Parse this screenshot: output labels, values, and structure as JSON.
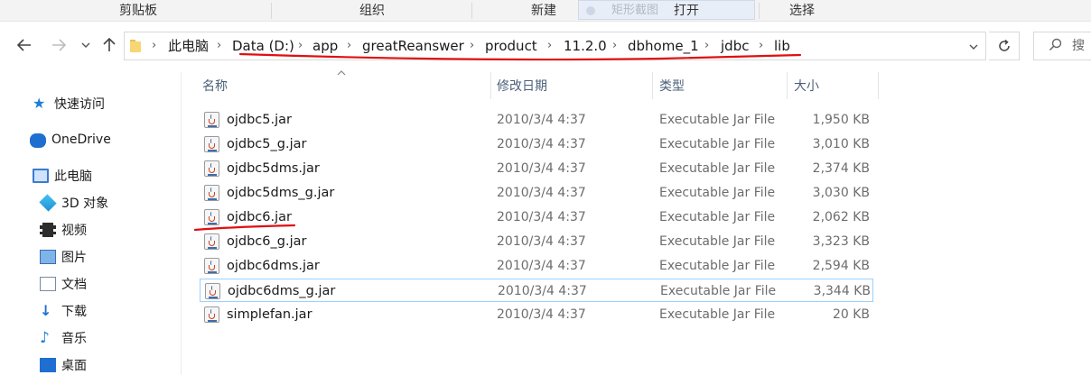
{
  "ribbon": {
    "groups": [
      "剪贴板",
      "组织",
      "新建",
      "打开",
      "选择"
    ],
    "ghost_label": "矩形截图"
  },
  "nav": {
    "breadcrumbs": [
      "此电脑",
      "Data (D:)",
      "app",
      "greatReanswer",
      "product",
      "11.2.0",
      "dbhome_1",
      "jdbc",
      "lib"
    ],
    "search_placeholder": "搜"
  },
  "sidebar": {
    "items": [
      {
        "label": "快速访问",
        "icon": "star-icon"
      },
      {
        "label": "OneDrive",
        "icon": "cloud-icon"
      },
      {
        "label": "此电脑",
        "icon": "computer-icon"
      },
      {
        "label": "3D 对象",
        "icon": "3d-objects-icon"
      },
      {
        "label": "视频",
        "icon": "video-icon"
      },
      {
        "label": "图片",
        "icon": "pictures-icon"
      },
      {
        "label": "文档",
        "icon": "documents-icon"
      },
      {
        "label": "下载",
        "icon": "download-icon"
      },
      {
        "label": "音乐",
        "icon": "music-icon"
      },
      {
        "label": "桌面",
        "icon": "desktop-icon"
      }
    ]
  },
  "list": {
    "columns": {
      "name": "名称",
      "date": "修改日期",
      "type": "类型",
      "size": "大小"
    },
    "files": [
      {
        "name": "ojdbc5.jar",
        "date": "2010/3/4 4:37",
        "type": "Executable Jar File",
        "size": "1,950 KB"
      },
      {
        "name": "ojdbc5_g.jar",
        "date": "2010/3/4 4:37",
        "type": "Executable Jar File",
        "size": "3,010 KB"
      },
      {
        "name": "ojdbc5dms.jar",
        "date": "2010/3/4 4:37",
        "type": "Executable Jar File",
        "size": "2,374 KB"
      },
      {
        "name": "ojdbc5dms_g.jar",
        "date": "2010/3/4 4:37",
        "type": "Executable Jar File",
        "size": "3,030 KB"
      },
      {
        "name": "ojdbc6.jar",
        "date": "2010/3/4 4:37",
        "type": "Executable Jar File",
        "size": "2,062 KB"
      },
      {
        "name": "ojdbc6_g.jar",
        "date": "2010/3/4 4:37",
        "type": "Executable Jar File",
        "size": "3,323 KB"
      },
      {
        "name": "ojdbc6dms.jar",
        "date": "2010/3/4 4:37",
        "type": "Executable Jar File",
        "size": "2,594 KB"
      },
      {
        "name": "ojdbc6dms_g.jar",
        "date": "2010/3/4 4:37",
        "type": "Executable Jar File",
        "size": "3,344 KB"
      },
      {
        "name": "simplefan.jar",
        "date": "2010/3/4 4:37",
        "type": "Executable Jar File",
        "size": "20 KB"
      }
    ]
  },
  "colors": {
    "annotation": "#e01010",
    "focus_border": "#99d1ff",
    "header_text": "#4c607a"
  }
}
